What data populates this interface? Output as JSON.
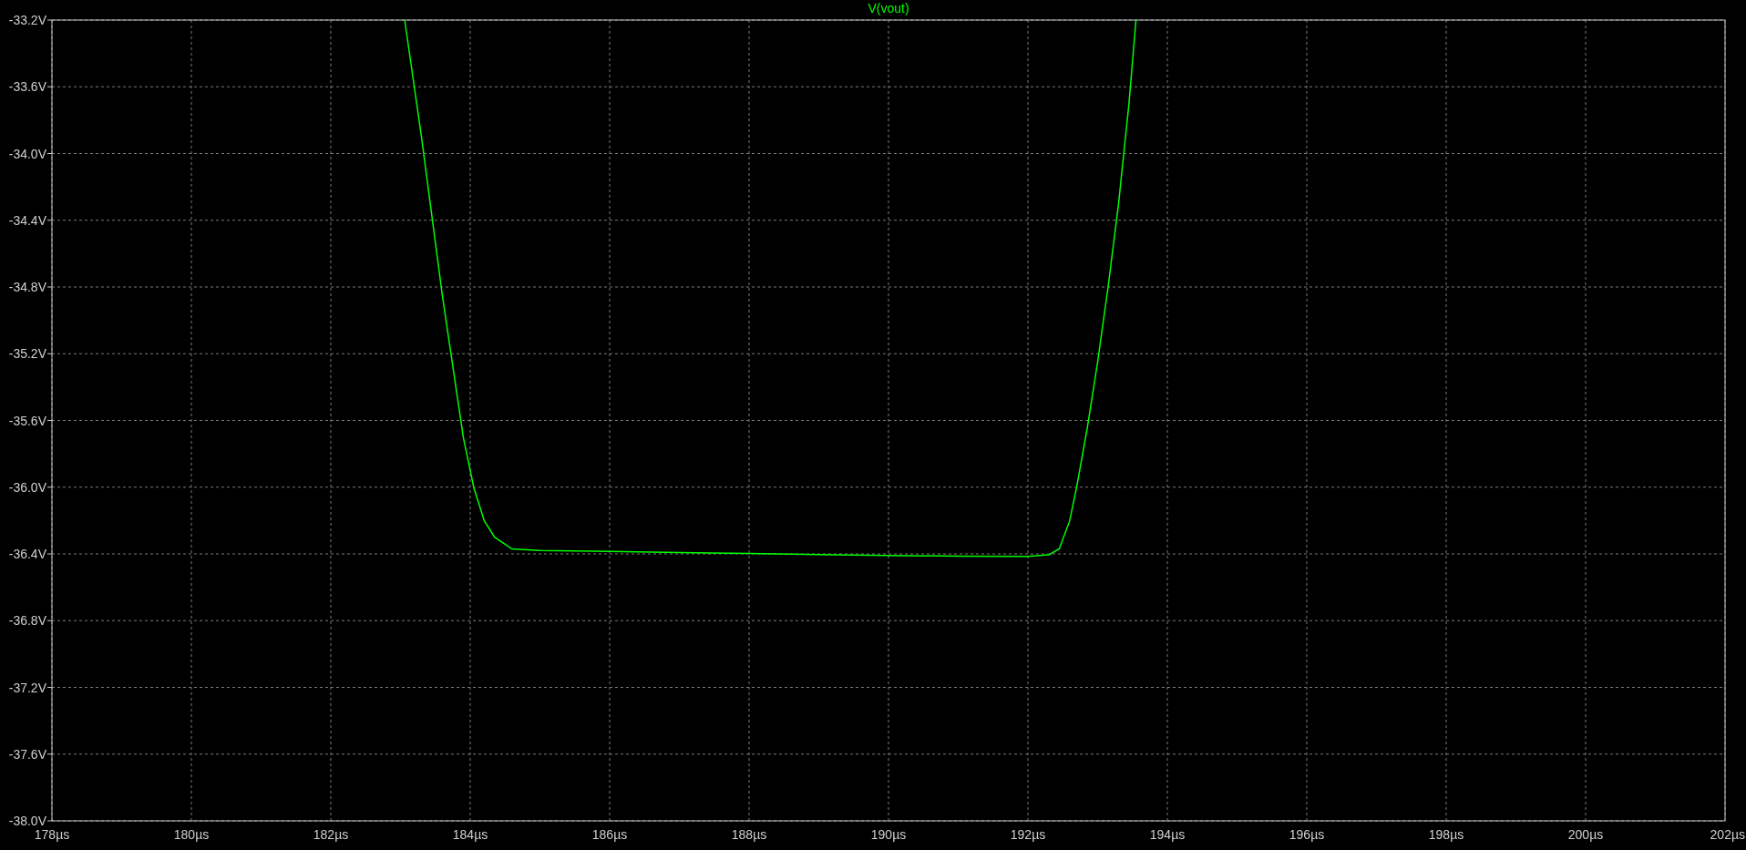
{
  "plot": {
    "chart_data": {
      "type": "line",
      "grid": true,
      "x": [
        183.06,
        183.3,
        183.6,
        183.9,
        184.05,
        184.2,
        184.35,
        184.6,
        185,
        186,
        187,
        188,
        189,
        190,
        191,
        192,
        192.3,
        192.45,
        192.6,
        192.7,
        192.85,
        193,
        193.15,
        193.3,
        193.45,
        193.55
      ],
      "series": [
        {
          "name": "V(vout)",
          "color": "#00ff00",
          "values": [
            -33.2,
            -33.9,
            -34.85,
            -35.7,
            -36.0,
            -36.2,
            -36.3,
            -36.37,
            -36.38,
            -36.385,
            -36.392,
            -36.398,
            -36.404,
            -36.41,
            -36.413,
            -36.415,
            -36.405,
            -36.37,
            -36.2,
            -36.0,
            -35.65,
            -35.25,
            -34.8,
            -34.3,
            -33.7,
            -33.2
          ]
        }
      ],
      "xlim": [
        178,
        202
      ],
      "ylim": [
        -38.0,
        -33.2
      ],
      "xticks": [
        {
          "value": 178,
          "label": "178µs"
        },
        {
          "value": 180,
          "label": "180µs"
        },
        {
          "value": 182,
          "label": "182µs"
        },
        {
          "value": 184,
          "label": "184µs"
        },
        {
          "value": 186,
          "label": "186µs"
        },
        {
          "value": 188,
          "label": "188µs"
        },
        {
          "value": 190,
          "label": "190µs"
        },
        {
          "value": 192,
          "label": "192µs"
        },
        {
          "value": 194,
          "label": "194µs"
        },
        {
          "value": 196,
          "label": "196µs"
        },
        {
          "value": 198,
          "label": "198µs"
        },
        {
          "value": 200,
          "label": "200µs"
        },
        {
          "value": 202,
          "label": "202µs"
        }
      ],
      "yticks": [
        {
          "value": -33.2,
          "label": "-33.2V"
        },
        {
          "value": -33.6,
          "label": "-33.6V"
        },
        {
          "value": -34.0,
          "label": "-34.0V"
        },
        {
          "value": -34.4,
          "label": "-34.4V"
        },
        {
          "value": -34.8,
          "label": "-34.8V"
        },
        {
          "value": -35.2,
          "label": "-35.2V"
        },
        {
          "value": -35.6,
          "label": "-35.6V"
        },
        {
          "value": -36.0,
          "label": "-36.0V"
        },
        {
          "value": -36.4,
          "label": "-36.4V"
        },
        {
          "value": -36.8,
          "label": "-36.8V"
        },
        {
          "value": -37.2,
          "label": "-37.2V"
        },
        {
          "value": -37.6,
          "label": "-37.6V"
        },
        {
          "value": -38.0,
          "label": "-38.0V"
        }
      ]
    }
  }
}
